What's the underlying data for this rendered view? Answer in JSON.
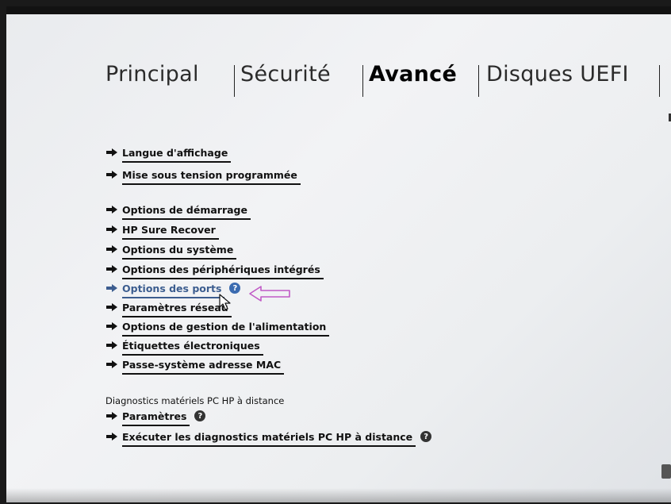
{
  "tabs": [
    {
      "label": "Principal",
      "active": false
    },
    {
      "label": "Sécurité",
      "active": false
    },
    {
      "label": "Avancé",
      "active": true
    },
    {
      "label": "Disques UEFI",
      "active": false
    }
  ],
  "menu_group1": [
    {
      "label": "Langue d'affichage"
    },
    {
      "label": "Mise sous tension programmée"
    }
  ],
  "menu_group2": [
    {
      "label": "Options de démarrage"
    },
    {
      "label": "HP Sure Recover"
    },
    {
      "label": "Options du système"
    },
    {
      "label": "Options des périphériques intégrés"
    },
    {
      "label": "Options des ports",
      "selected": true
    },
    {
      "label": "Paramètres réseau"
    },
    {
      "label": "Options de gestion de l'alimentation"
    },
    {
      "label": "Étiquettes électroniques"
    },
    {
      "label": "Passe-système adresse MAC"
    }
  ],
  "remote_diag": {
    "title": "Diagnostics matériels PC HP à distance",
    "items": [
      {
        "label": "Paramètres"
      },
      {
        "label": "Exécuter les diagnostics matériels PC HP à distance"
      }
    ]
  },
  "help_glyph": "?",
  "icons": {
    "arrow": "right-arrow-icon",
    "help": "help-icon",
    "cursor": "mouse-cursor-icon",
    "annotation": "hollow-left-arrow-icon"
  },
  "colors": {
    "selected": "#3c5d8f",
    "help_selected": "#3b6bb0",
    "annotation": "#c05ac6",
    "text": "#111111"
  }
}
